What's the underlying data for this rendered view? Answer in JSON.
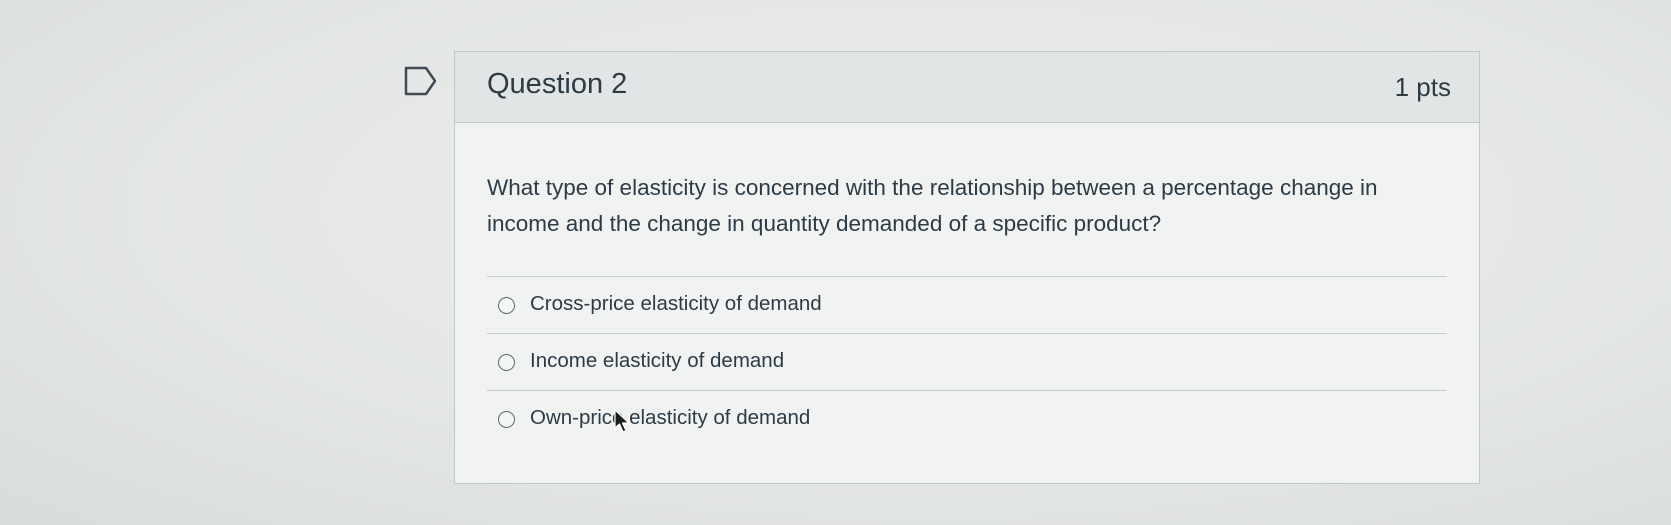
{
  "question": {
    "title": "Question 2",
    "points": "1 pts",
    "text": "What type of elasticity is concerned with the relationship between a percentage change in income and the change in quantity demanded of a specific product?"
  },
  "answers": [
    {
      "label": "Cross-price elasticity of demand",
      "selected": false
    },
    {
      "label": "Income elasticity of demand",
      "selected": false
    },
    {
      "label": "Own-price elasticity of demand",
      "selected": false
    }
  ],
  "icons": {
    "flag": "flag-outline-icon",
    "cursor": "mouse-pointer-icon"
  },
  "colors": {
    "text": "#2d3b45",
    "header_bg": "#e2e5e5",
    "border": "#c3c7c8"
  }
}
